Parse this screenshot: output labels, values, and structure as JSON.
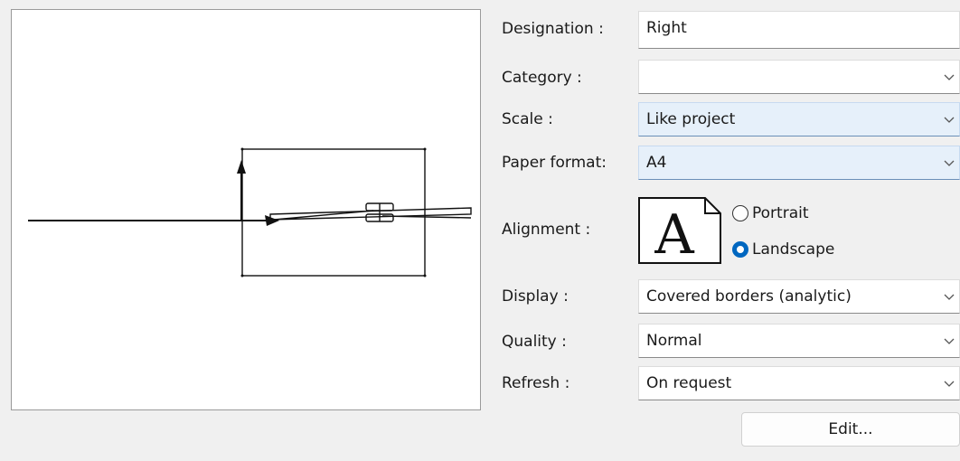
{
  "labels": {
    "designation": "Designation :",
    "category": "Category :",
    "scale": "Scale :",
    "paper_format": "Paper format:",
    "alignment": "Alignment :",
    "display": "Display :",
    "quality": "Quality :",
    "refresh": "Refresh :"
  },
  "values": {
    "designation": "Right",
    "category": "",
    "scale": "Like project",
    "paper_format": "A4",
    "display": "Covered borders (analytic)",
    "quality": "Normal",
    "refresh": "On request"
  },
  "alignment": {
    "icon_letter": "A",
    "portrait_label": "Portrait",
    "landscape_label": "Landscape",
    "selected": "Landscape"
  },
  "buttons": {
    "edit_label": "Edit..."
  },
  "colors": {
    "accent": "#0067c0",
    "highlight_field": "#e6f0fa",
    "window_bg": "#f0f0f0"
  }
}
